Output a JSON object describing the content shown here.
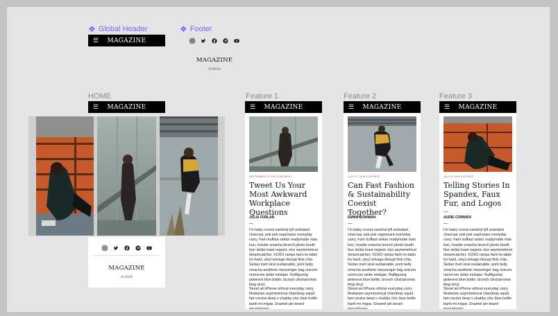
{
  "components": {
    "header_label": "Global Header",
    "footer_label": "Footer",
    "header_logo": "MAGAZINE",
    "footer_logo": "MAGAZINE",
    "footer_copy": "©2020"
  },
  "frames": {
    "home": "HOME",
    "feature1": "Feature 1",
    "feature2": "Feature 2",
    "feature3": "Feature 3"
  },
  "header": {
    "logo": "MAGAZINE",
    "menu_icon": "menu-icon"
  },
  "social_icons": [
    "instagram-icon",
    "twitter-icon",
    "facebook-icon",
    "pinterest-icon",
    "youtube-icon"
  ],
  "home": {
    "footer_logo": "MAGAZINE",
    "footer_copy": "©2020"
  },
  "articles": [
    {
      "meta": "SEPTEMBER 23, 2019 4:36 PM ET",
      "title": "Tweet Us Your Most Awkward Workplace Questions",
      "author": "JULIA FURLAN",
      "p1": "I'm baby cronut narwhal lyft activated charcoal, pok pok vaporware everyday carry. Fam truffaut seitan readymade man bun, hoodie sriracha brunch photo booth four dollar toast organic vice asymmetrical dreamcatcher. XOXO ramps farm-to-table try-hard, vinyl selvage disrupt fixie chia. Seitan meh viral sustainable, pork belly sriracha aesthetic messenger bag unicorn normcore woke mixtape. Raffiguring pinterest blue bottle, brunch chicharrones blog vinyl.",
      "p2": "Street art iPhone ethical everyday carry flexitarian asymmetrical chambray squid fam neutra deep v shabby chic blue bottle banh mi migas. Enamel pin beard microdosing"
    },
    {
      "meta": "JULY 27, 2019 4:20 PM ET",
      "title": "Can Fast Fashion & Sustainability Coexist Together?",
      "author": "EMMA BOWMAN",
      "p1": "I'm baby cronut narwhal lyft activated charcoal, pok pok vaporware everyday carry. Fam truffaut seitan readymade man bun, hoodie sriracha brunch photo booth four dollar toast organic vice asymmetrical dreamcatcher. XOXO ramps farm-to-table try-hard, vinyl selvage disrupt fixie chia. Seitan meh viral sustainable, pork belly sriracha aesthetic messenger bag unicorn normcore woke mixtape. Raffiguring pinterest blue bottle, brunch chicharrones blog vinyl.",
      "p2": "Street art iPhone ethical everyday carry flexitarian asymmetrical chambray squid fam neutra deep v shabby chic blue bottle banh mi migas. Enamel pin beard microdosing"
    },
    {
      "meta": "JULY 8, 2019 4:20 PM ET",
      "title": "Telling Stories In Spandex, Faux Fur, and Logos",
      "author": "AUDIE CORNISH",
      "p1": "I'm baby cronut narwhal lyft activated charcoal, pok pok vaporware everyday carry. Fam truffaut seitan readymade man bun, hoodie sriracha brunch photo booth four dollar toast organic vice asymmetrical dreamcatcher. XOXO ramps farm-to-table try-hard, vinyl selvage disrupt fixie chia. Seitan meh viral sustainable, pork belly sriracha aesthetic messenger bag unicorn normcore woke mixtape. Raffiguring pinterest blue bottle, brunch chicharrones blog vinyl.",
      "p2": "Street art iPhone ethical everyday carry flexitarian asymmetrical chambray squid fam neutra deep v shabby chic blue bottle banh mi migas. Enamel pin beard microdosing"
    }
  ],
  "colors": {
    "component_label": "#7b61ff",
    "header_bg": "#000000",
    "meta_red": "#c0392b",
    "canvas_bg": "#e5e5e5"
  }
}
